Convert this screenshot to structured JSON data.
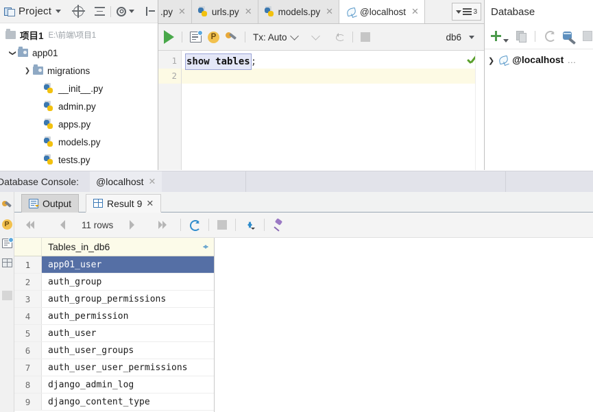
{
  "project_panel": {
    "header": {
      "title": "Project",
      "icons": [
        "project-icon",
        "chevron-down-icon",
        "target-icon",
        "collapse-all-icon",
        "gear-icon",
        "hide-panel-icon"
      ]
    },
    "tree": [
      {
        "label": "项目1",
        "path": "E:\\前端\\项目1",
        "type": "root-folder",
        "bold": true,
        "arrow": "none",
        "indent": 0
      },
      {
        "label": "app01",
        "path": "",
        "type": "folder",
        "bold": false,
        "arrow": "down",
        "indent": 1
      },
      {
        "label": "migrations",
        "path": "",
        "type": "folder-blue",
        "bold": false,
        "arrow": "right",
        "indent": 2
      },
      {
        "label": "__init__.py",
        "path": "",
        "type": "python",
        "bold": false,
        "arrow": "none",
        "indent": 3
      },
      {
        "label": "admin.py",
        "path": "",
        "type": "python",
        "bold": false,
        "arrow": "none",
        "indent": 3
      },
      {
        "label": "apps.py",
        "path": "",
        "type": "python",
        "bold": false,
        "arrow": "none",
        "indent": 3
      },
      {
        "label": "models.py",
        "path": "",
        "type": "python",
        "bold": false,
        "arrow": "none",
        "indent": 3
      },
      {
        "label": "tests.py",
        "path": "",
        "type": "python",
        "bold": false,
        "arrow": "none",
        "indent": 3
      }
    ]
  },
  "editor": {
    "tabs": [
      {
        "label": ".py",
        "icon": "python-icon",
        "active": false,
        "closable": true
      },
      {
        "label": "urls.py",
        "icon": "python-icon",
        "active": false,
        "closable": true
      },
      {
        "label": "models.py",
        "icon": "python-icon",
        "active": false,
        "closable": true
      },
      {
        "label": "@localhost",
        "icon": "mysql-dolphin-icon",
        "active": true,
        "closable": true
      }
    ],
    "tab_overflow_count": "3",
    "toolbar": {
      "run_label": "Run",
      "transaction_label": "Tx: Auto",
      "datasource_label": "db6"
    },
    "lines": [
      {
        "number": "1",
        "code": "show tables",
        "suffix": ";",
        "selected": true,
        "highlighted": false
      },
      {
        "number": "2",
        "code": "",
        "suffix": "",
        "selected": false,
        "highlighted": true
      }
    ],
    "inspection_status": "ok"
  },
  "database_panel": {
    "title": "Database",
    "toolbar_icons": [
      "add-icon",
      "copy-icon",
      "refresh-icon",
      "db-properties-icon",
      "more-icon"
    ],
    "tree": [
      {
        "label": "@localhost",
        "suffix": "…",
        "icon": "mysql-dolphin-icon"
      }
    ]
  },
  "console": {
    "title": "Database Console:",
    "tab_label": "@localhost",
    "result_tabs": [
      {
        "label": "Output",
        "icon": "output-icon",
        "active": true,
        "closable": false
      },
      {
        "label": "Result 9",
        "icon": "table-icon",
        "active": false,
        "closable": true
      }
    ],
    "toolbar": {
      "rows_label": "11 rows",
      "icons": [
        "first-page-icon",
        "prev-page-icon",
        "next-page-icon",
        "last-page-icon",
        "refresh-icon",
        "stop-icon",
        "transpose-icon",
        "pin-icon"
      ]
    },
    "grid": {
      "columns": [
        "Tables_in_db6"
      ],
      "rows": [
        {
          "n": "1",
          "value": "app01_user",
          "selected": true
        },
        {
          "n": "2",
          "value": "auth_group",
          "selected": false
        },
        {
          "n": "3",
          "value": "auth_group_permissions",
          "selected": false
        },
        {
          "n": "4",
          "value": "auth_permission",
          "selected": false
        },
        {
          "n": "5",
          "value": "auth_user",
          "selected": false
        },
        {
          "n": "6",
          "value": "auth_user_groups",
          "selected": false
        },
        {
          "n": "7",
          "value": "auth_user_user_permissions",
          "selected": false
        },
        {
          "n": "8",
          "value": "django_admin_log",
          "selected": false
        },
        {
          "n": "9",
          "value": "django_content_type",
          "selected": false
        }
      ]
    }
  },
  "left_strip_icons": [
    "wrench-icon",
    "p-icon",
    "history-icon",
    "grid-icon",
    "blank-icon"
  ],
  "colors": {
    "selection_blue": "#556fa5",
    "header_cream": "#fcfbe9",
    "console_header": "#e2e3ea",
    "run_green": "#49a84a",
    "accent_blue": "#2f8ccc"
  }
}
